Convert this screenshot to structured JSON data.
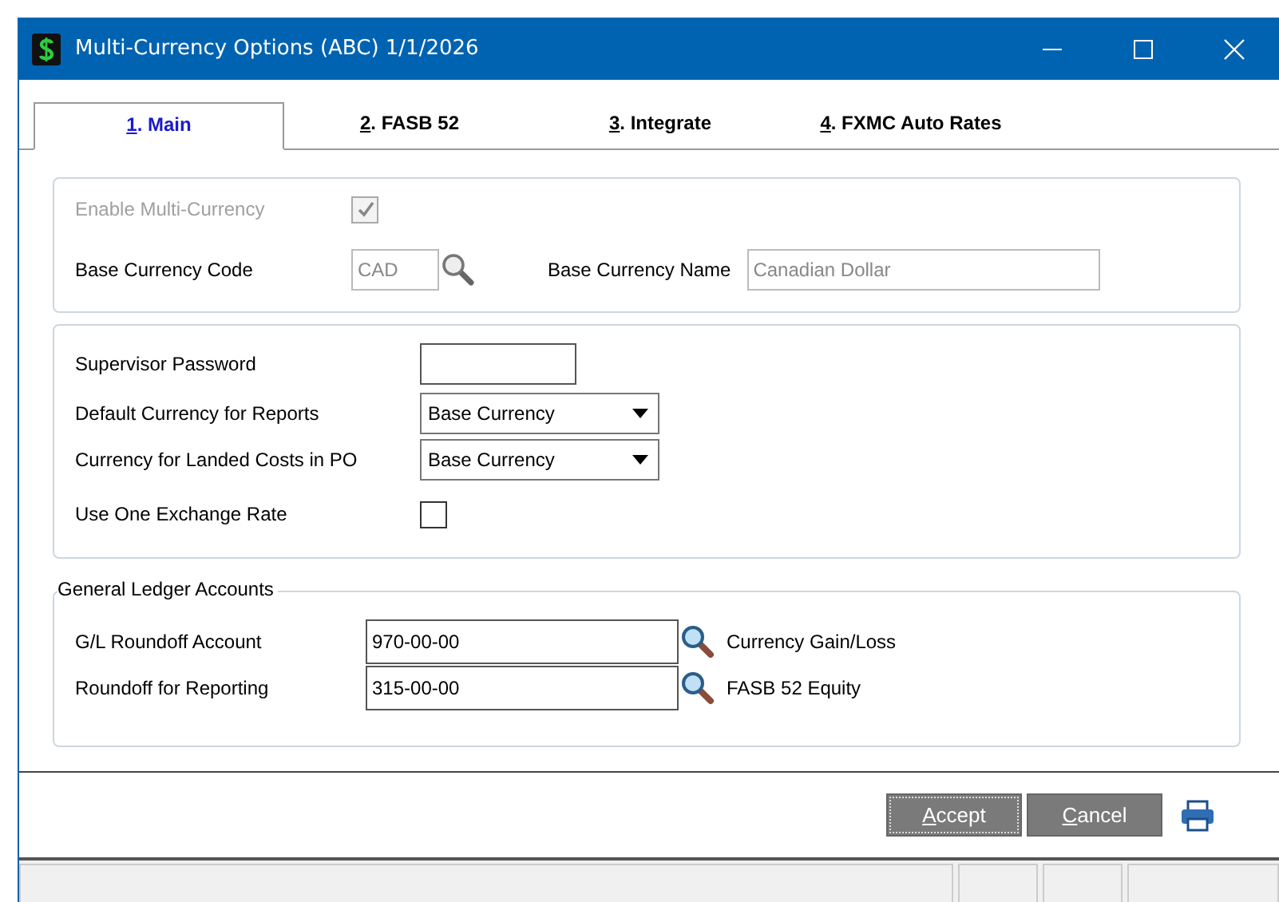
{
  "window": {
    "title": "Multi-Currency Options  (ABC) 1/1/2026"
  },
  "tabs": [
    {
      "key": "1",
      "label": ". Main",
      "selected": true
    },
    {
      "key": "2",
      "label": ". FASB 52",
      "selected": false
    },
    {
      "key": "3",
      "label": ". Integrate",
      "selected": false
    },
    {
      "key": "4",
      "label": ". FXMC Auto Rates",
      "selected": false
    }
  ],
  "currency": {
    "enable_label": "Enable Multi-Currency",
    "enable_checked": true,
    "enable_disabled": true,
    "code_label": "Base Currency Code",
    "code_value": "CAD",
    "name_label": "Base Currency Name",
    "name_value": "Canadian Dollar"
  },
  "options": [
    {
      "kind": "text",
      "label": "Supervisor Password"
    },
    {
      "kind": "dropdown",
      "label": "Default Currency for Reports",
      "value": "Base Currency"
    },
    {
      "kind": "dropdown",
      "label": "Currency for Landed Costs in PO",
      "value": "Base Currency"
    },
    {
      "kind": "checkbox",
      "label": "Use One Exchange Rate",
      "checked": false
    }
  ],
  "gl": {
    "title": "General Ledger Accounts",
    "rows": [
      {
        "label": "G/L Roundoff Account",
        "value": "970-00-00",
        "description": "Currency Gain/Loss"
      },
      {
        "label": "Roundoff for Reporting",
        "value": "315-00-00",
        "description": "FASB 52 Equity"
      }
    ]
  },
  "buttons": [
    {
      "key": "A",
      "label": "ccept",
      "focused": true
    },
    {
      "key": "C",
      "label": "ancel",
      "focused": false
    }
  ]
}
